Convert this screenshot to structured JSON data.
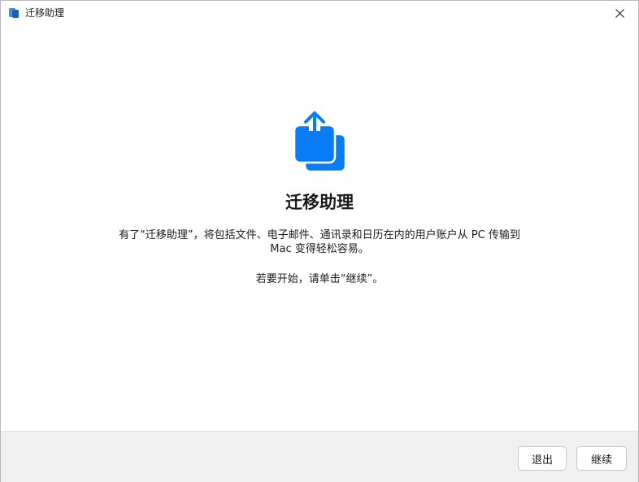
{
  "window": {
    "title": "迁移助理",
    "app_icon": "migration-assistant-icon",
    "close_icon": "close-icon"
  },
  "main": {
    "hero_icon": "share-upload-icon",
    "heading": "迁移助理",
    "description_line1": "有了“迁移助理”，将包括文件、电子邮件、通讯录和日历在内的用户账户从 PC 传输到",
    "description_line2": "Mac 变得轻松容易。",
    "hint": "若要开始，请单击“继续”。"
  },
  "footer": {
    "quit_label": "退出",
    "continue_label": "继续"
  },
  "colors": {
    "accent": "#0a7cf5",
    "footer_bg": "#f1f0f0",
    "text": "#1a1a1a"
  }
}
